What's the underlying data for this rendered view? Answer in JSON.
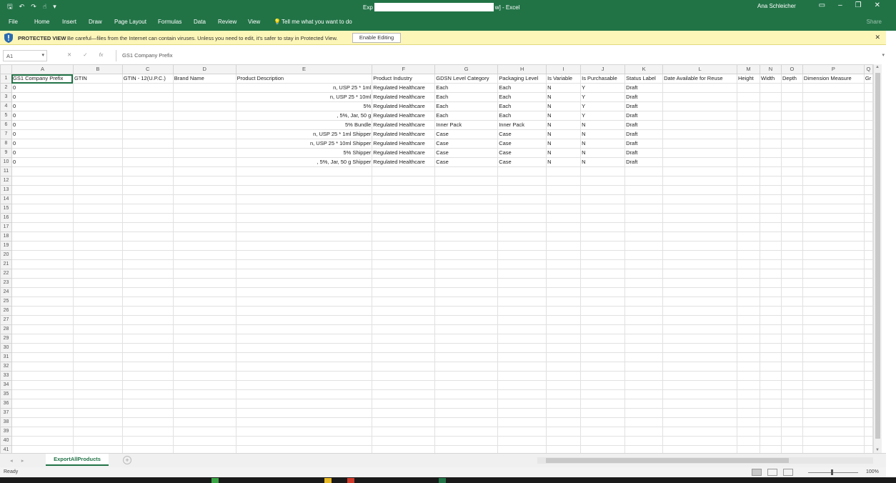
{
  "window": {
    "title_prefix": "Exp",
    "title_suffix": "w] - Excel",
    "user": "Ana Schleicher",
    "qat": {
      "save": "🖫",
      "undo": "↶",
      "redo": "↷",
      "touch": "☝",
      "customize": "▾"
    },
    "buttons": {
      "ribbon_display": "▭",
      "minimize": "–",
      "restore": "❐",
      "close": "✕"
    }
  },
  "ribbon": {
    "tabs": [
      "File",
      "Home",
      "Insert",
      "Draw",
      "Page Layout",
      "Formulas",
      "Data",
      "Review",
      "View"
    ],
    "tell_me": "Tell me what you want to do",
    "share": "Share"
  },
  "protected_view": {
    "label": "PROTECTED VIEW",
    "message": "Be careful—files from the Internet can contain viruses. Unless you need to edit, it's safer to stay in Protected View.",
    "enable_button": "Enable Editing",
    "close": "✕"
  },
  "formula_bar": {
    "name_box": "A1",
    "formula": "GS1 Company Prefix",
    "cancel": "✕",
    "enter": "✓",
    "fx": "fx"
  },
  "sheet": {
    "columns": [
      "A",
      "B",
      "C",
      "D",
      "E",
      "F",
      "G",
      "H",
      "I",
      "J",
      "K",
      "L",
      "M",
      "N",
      "O",
      "P",
      "Q"
    ],
    "headers": [
      "GS1 Company Prefix",
      "GTIN",
      "GTIN - 12(U.P.C.)",
      "Brand Name",
      "Product Description",
      "Product Industry",
      "GDSN Level Category",
      "Packaging Level",
      "Is Variable",
      "Is Purchasable",
      "Status Label",
      "Date Available for Reuse",
      "Height",
      "Width",
      "Depth",
      "Dimension Measure",
      "Gr"
    ],
    "rows": [
      [
        "0",
        "",
        "",
        "",
        "n, USP 25 * 1ml",
        "Regulated Healthcare",
        "Each",
        "Each",
        "N",
        "Y",
        "Draft",
        "",
        "",
        "",
        "",
        "",
        ""
      ],
      [
        "0",
        "",
        "",
        "",
        "n, USP 25 * 10ml",
        "Regulated Healthcare",
        "Each",
        "Each",
        "N",
        "Y",
        "Draft",
        "",
        "",
        "",
        "",
        "",
        ""
      ],
      [
        "0",
        "",
        "",
        "",
        "5%",
        "Regulated Healthcare",
        "Each",
        "Each",
        "N",
        "Y",
        "Draft",
        "",
        "",
        "",
        "",
        "",
        ""
      ],
      [
        "0",
        "",
        "",
        "",
        ", 5%, Jar, 50 g",
        "Regulated Healthcare",
        "Each",
        "Each",
        "N",
        "Y",
        "Draft",
        "",
        "",
        "",
        "",
        "",
        ""
      ],
      [
        "0",
        "",
        "",
        "",
        "5% Bundle",
        "Regulated Healthcare",
        "Inner Pack",
        "Inner Pack",
        "N",
        "N",
        "Draft",
        "",
        "",
        "",
        "",
        "",
        ""
      ],
      [
        "0",
        "",
        "",
        "",
        "n, USP 25 * 1ml Shipper",
        "Regulated Healthcare",
        "Case",
        "Case",
        "N",
        "N",
        "Draft",
        "",
        "",
        "",
        "",
        "",
        ""
      ],
      [
        "0",
        "",
        "",
        "",
        "n, USP 25 * 10ml Shipper",
        "Regulated Healthcare",
        "Case",
        "Case",
        "N",
        "N",
        "Draft",
        "",
        "",
        "",
        "",
        "",
        ""
      ],
      [
        "0",
        "",
        "",
        "",
        "5% Shipper",
        "Regulated Healthcare",
        "Case",
        "Case",
        "N",
        "N",
        "Draft",
        "",
        "",
        "",
        "",
        "",
        ""
      ],
      [
        "0",
        "",
        "",
        "",
        ", 5%, Jar, 50 g Shipper",
        "Regulated Healthcare",
        "Case",
        "Case",
        "N",
        "N",
        "Draft",
        "",
        "",
        "",
        "",
        "",
        ""
      ]
    ],
    "row_count": 41
  },
  "sheet_tabs": {
    "active": "ExportAllProducts",
    "add": "+",
    "nav_prev": "◂",
    "nav_next": "▸"
  },
  "status": {
    "ready": "Ready",
    "zoom": "100%"
  },
  "colors": {
    "brand": "#217346",
    "pv_background": "#fdf6b9",
    "shield": "#2b6cb0"
  }
}
